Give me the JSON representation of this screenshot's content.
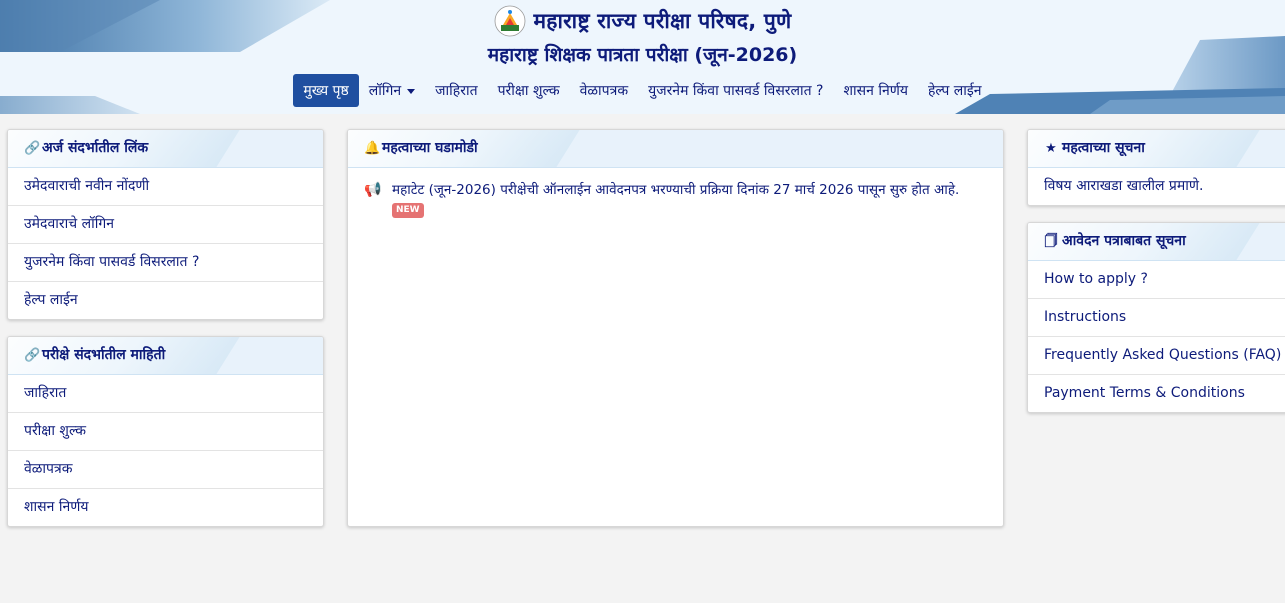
{
  "header": {
    "org_title": "महाराष्ट्र राज्य परीक्षा परिषद, पुणे",
    "exam_title": "महाराष्ट्र शिक्षक पात्रता परीक्षा (जून-2026)",
    "logo_icon": "state-council-emblem-icon"
  },
  "nav": {
    "items": [
      {
        "label": "मुख्य पृष्ठ",
        "active": true
      },
      {
        "label": "लॉगिन",
        "dropdown": true
      },
      {
        "label": "जाहिरात"
      },
      {
        "label": "परीक्षा शुल्क"
      },
      {
        "label": "वेळापत्रक"
      },
      {
        "label": "युजरनेम किंवा पासवर्ड विसरलात ?"
      },
      {
        "label": "शासन निर्णय"
      },
      {
        "label": "हेल्प लाईन"
      }
    ]
  },
  "left": {
    "card1": {
      "title": "अर्ज संदर्भातील लिंक",
      "icon": "link-icon",
      "items": [
        "उमेदवाराची नवीन नोंदणी",
        "उमेदवाराचे लॉगिन",
        "युजरनेम किंवा पासवर्ड विसरलात ?",
        "हेल्प लाईन"
      ]
    },
    "card2": {
      "title": "परीक्षे संदर्भातील माहिती",
      "icon": "link-icon",
      "items": [
        "जाहिरात",
        "परीक्षा शुल्क",
        "वेळापत्रक",
        "शासन निर्णय"
      ]
    }
  },
  "center": {
    "title": "महत्वाच्या घडामोडी",
    "icon": "bell-icon",
    "news": [
      {
        "text": "महाटेट (जून-2026) परीक्षेची ऑनलाईन आवेदनपत्र भरण्याची प्रक्रिया दिनांक 27 मार्च 2026 पासून सुरु होत आहे.",
        "badge": "NEW",
        "icon": "megaphone-icon"
      }
    ]
  },
  "right": {
    "card1": {
      "title": "महत्वाच्या सूचना",
      "icon": "star-icon",
      "items": [
        "विषय आराखडा खालील प्रमाणे."
      ]
    },
    "card2": {
      "title": "आवेदन पत्राबाबत सूचना",
      "icon": "document-icon",
      "items": [
        "How to apply ?",
        "Instructions",
        "Frequently Asked Questions (FAQ)",
        "Payment Terms & Conditions"
      ]
    }
  },
  "colors": {
    "accent": "#1f4fa0",
    "text": "#0d1b7a",
    "badge": "#e57373"
  }
}
